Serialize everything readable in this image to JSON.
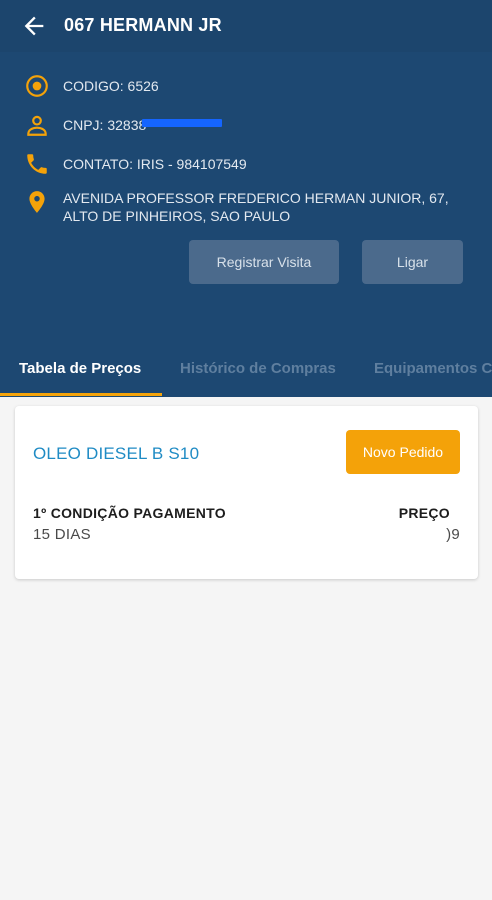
{
  "header": {
    "title": "067 HERMANN JR",
    "codigo": "CODIGO: 6526",
    "cnpj": "CNPJ: 32838",
    "contato": "CONTATO: IRIS - 984107549",
    "endereco": "AVENIDA PROFESSOR FREDERICO HERMAN JUNIOR, 67, ALTO DE PINHEIROS, SAO PAULO",
    "btn_registrar": "Registrar Visita",
    "btn_ligar": "Ligar"
  },
  "tabs": [
    {
      "label": "Tabela de Preços",
      "active": true
    },
    {
      "label": "Histórico de Compras",
      "active": false
    },
    {
      "label": "Equipamentos C",
      "active": false
    }
  ],
  "card": {
    "product": "OLEO DIESEL B S10",
    "btn_novo": "Novo Pedido",
    "col1_header": "1º CONDIÇÃO PAGAMENTO",
    "col1_value": "15 DIAS",
    "col2_header": "PREÇO",
    "col2_value": ")9"
  },
  "colors": {
    "header_bg": "#1d4872",
    "accent": "#f4a209",
    "product_text": "#1f8bc4"
  },
  "icons": {
    "back": "arrow-left-icon",
    "codigo": "target-icon",
    "cnpj": "person-icon",
    "contato": "phone-icon",
    "endereco": "location-pin-icon"
  }
}
